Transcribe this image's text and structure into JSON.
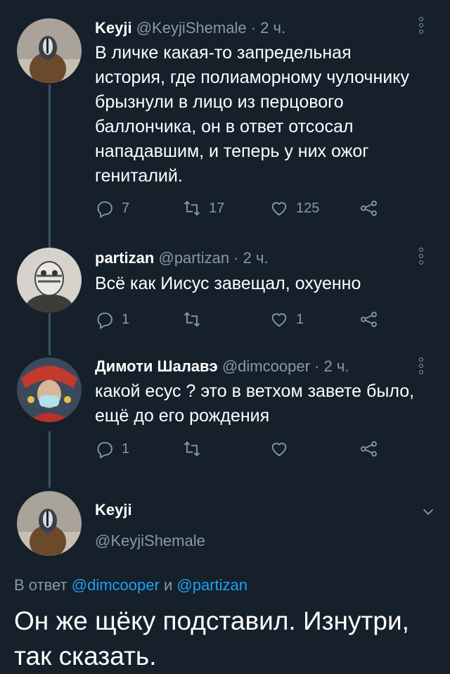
{
  "colors": {
    "background": "#15202b",
    "secondary_text": "#8899a6",
    "link": "#1da1f2",
    "thread_line": "#3d5466"
  },
  "tweets": [
    {
      "name": "Keyji",
      "handle": "@KeyjiShemale",
      "time": "· 2 ч.",
      "text": "В личке какая-то запредельная история, где полиаморному чулочнику брызнули в лицо из перцового баллончика, он в ответ отсосал нападавшим, и теперь у них ожог гениталий.",
      "replies": "7",
      "retweets": "17",
      "likes": "125"
    },
    {
      "name": "partizan",
      "handle": "@partizan",
      "time": "· 2 ч.",
      "text": "Всё как Иисус завещал, охуенно",
      "replies": "1",
      "retweets": "",
      "likes": "1"
    },
    {
      "name": "Димоти Шалавэ",
      "handle": "@dimcooper",
      "time": "· 2 ч.",
      "text": "какой есус ? это в ветхом завете было, ещё до его рождения",
      "replies": "1",
      "retweets": "",
      "likes": ""
    }
  ],
  "main_tweet": {
    "name": "Keyji",
    "handle": "@KeyjiShemale",
    "reply_prefix": "В ответ",
    "reply_user_1": "@dimcooper",
    "reply_joiner": "и",
    "reply_user_2": "@partizan",
    "text": "Он же щёку подставил. Изнутри, так сказать."
  },
  "icons": {
    "reply": "reply-icon",
    "retweet": "retweet-icon",
    "like": "like-icon",
    "share": "share-icon",
    "more": "more-icon",
    "chevron": "chevron-down-icon"
  }
}
